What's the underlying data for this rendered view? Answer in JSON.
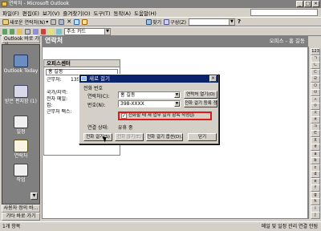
{
  "window": {
    "title": "연락처 - Microsoft Outlook"
  },
  "menubar": {
    "items": [
      "파일(F)",
      "편집(E)",
      "보기(V)",
      "즐겨찾기(O)",
      "도구(T)",
      "동작(A)",
      "도움말(H)"
    ],
    "help_placeholder": ""
  },
  "toolbar1": {
    "new_label": "새로운 연락처(N)",
    "find_label": "찾기",
    "organize_label": "구성(Z)",
    "search_value": ""
  },
  "toolbar2": {
    "address_label": "주소 카드"
  },
  "sidebar": {
    "header": "Outlook 바로 가기",
    "items": [
      {
        "label": "Outlook Today",
        "icon": "outlook-today-icon"
      },
      {
        "label": "받은 편지함 (1)",
        "icon": "inbox-icon"
      },
      {
        "label": "일정",
        "icon": "calendar-icon"
      },
      {
        "label": "연락처",
        "icon": "contacts-icon"
      },
      {
        "label": "작업",
        "icon": "tasks-icon"
      }
    ],
    "bottom1": "사용자 정의 바...",
    "bottom2": "기타 바로 가기"
  },
  "folder": {
    "title": "연락처",
    "right": "오피스 - 홍 길동"
  },
  "card": {
    "title": "오피스센터",
    "name": "홍 길동",
    "rows": [
      {
        "k": "근무처:",
        "v": "135-229"
      },
      {
        "k": "",
        "v": ""
      },
      {
        "k": "국가/지역:",
        "v": ""
      },
      {
        "k": "전자 메일:",
        "v": ""
      },
      {
        "k": "집:",
        "v": ""
      },
      {
        "k": "근무처 팩스:",
        "v": ""
      }
    ]
  },
  "alphabet": [
    "123",
    "ㄱ",
    "ㄴ",
    "ㄷ",
    "ㄹ",
    "ㅁ",
    "ㅂ",
    "ㅅ",
    "ㅇ",
    "ㅈ",
    "ㅊ",
    "ㅋ",
    "ㅌ",
    "ㅍ",
    "ㅎ",
    "a",
    "b",
    "c",
    "d",
    "e",
    "f",
    "g",
    "h",
    "i",
    "j"
  ],
  "dialog": {
    "title": "새로 걸기",
    "group": "전화 번호",
    "contact_label": "연락처(C):",
    "contact_value": "홍 길동",
    "number_label": "번호(N):",
    "number_value": "398-XXXX",
    "open_contact": "연락처 열기(O)",
    "dial_props": "전화 걸기 등록 정보(P)...",
    "checkbox_label": "전화할 때 새 업무 일지 항목 작성(J)",
    "status_label": "연결 상태:",
    "status_value": "유휴 중",
    "start_call": "전화 걸기(S)",
    "end_call": "전화 끊기(E)",
    "dial_options": "전화 걸기 옵션(D)...",
    "close": "닫기"
  },
  "status": {
    "left": "1개 항목",
    "right": "메일 및 일정 관리 연결 안됨"
  }
}
